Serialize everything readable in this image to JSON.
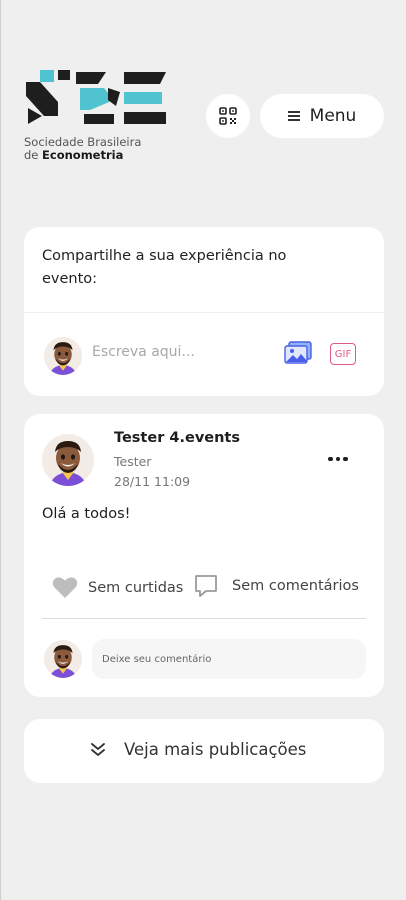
{
  "header": {
    "logo_line1": "Sociedade Brasileira",
    "logo_line2_prefix": "de ",
    "logo_line2_bold": "Econometria",
    "menu_label": "Menu",
    "qr_icon": "qr-code-icon",
    "menu_icon": "hamburger-icon"
  },
  "composer": {
    "prompt": "Compartilhe a sua experiência no evento:",
    "placeholder": "Escreva aqui...",
    "image_icon": "image-icon",
    "gif_label": "GIF"
  },
  "post": {
    "author": "Tester 4.events",
    "role": "Tester",
    "date": "28/11 11:09",
    "text": "Olá a todos!",
    "likes_label": "Sem curtidas",
    "comments_label": "Sem comentários",
    "comment_placeholder": "Deixe seu comentário"
  },
  "load_more": {
    "label": "Veja mais publicações",
    "icon": "chevron-down-icon"
  },
  "colors": {
    "background": "#efefef",
    "card": "#ffffff",
    "logo_cyan": "#4fc3d0",
    "gif_pink": "#e25a86",
    "image_blue": "#4a5ee8"
  }
}
